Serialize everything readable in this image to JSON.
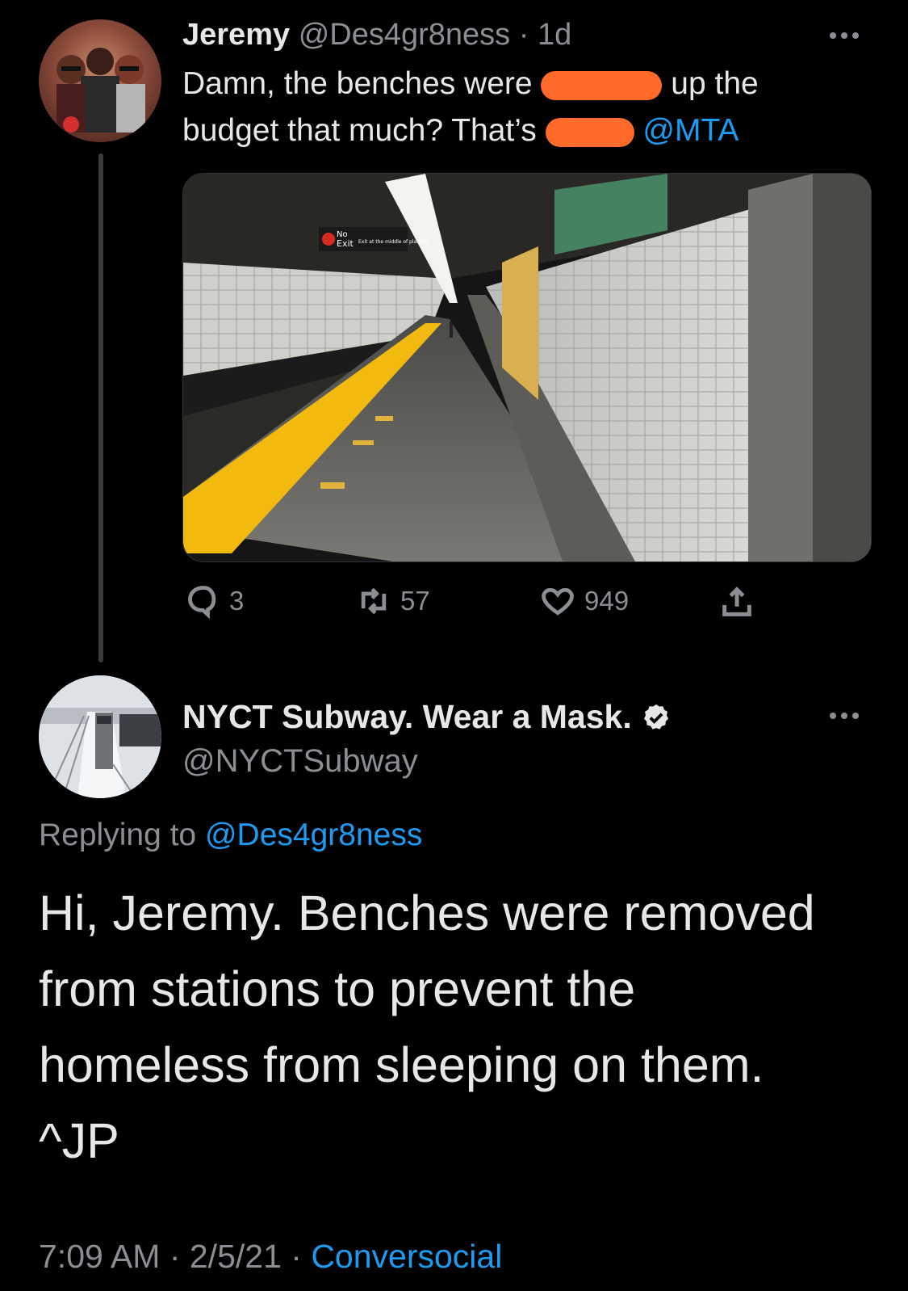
{
  "tweet1": {
    "display_name": "Jeremy",
    "handle": "@Des4gr8ness",
    "time": "1d",
    "text_part1": "Damn, the benches were",
    "text_part2": "up the",
    "text_part3": "budget that much? That’s",
    "mention": "@MTA",
    "photo_sign_no": "No",
    "photo_sign_exit": "Exit",
    "photo_sign_text": "Exit at the middle of platform",
    "stats": {
      "replies": "3",
      "retweets": "57",
      "likes": "949"
    }
  },
  "tweet2": {
    "display_name": "NYCT Subway. Wear a Mask.",
    "handle": "@NYCTSubway",
    "replying_prefix": "Replying to",
    "replying_handle": "@Des4gr8ness",
    "body_line1": "Hi, Jeremy. Benches were removed",
    "body_line2": "from stations to prevent the",
    "body_line3": "homeless from sleeping on them.",
    "body_line4": "^JP",
    "time": "7:09 AM",
    "date": "2/5/21",
    "source": "Conversocial"
  },
  "colors": {
    "background": "#000000",
    "link": "#1d9bf0",
    "redaction": "#ff6a2a",
    "platform_stripe": "#f2b90f"
  }
}
